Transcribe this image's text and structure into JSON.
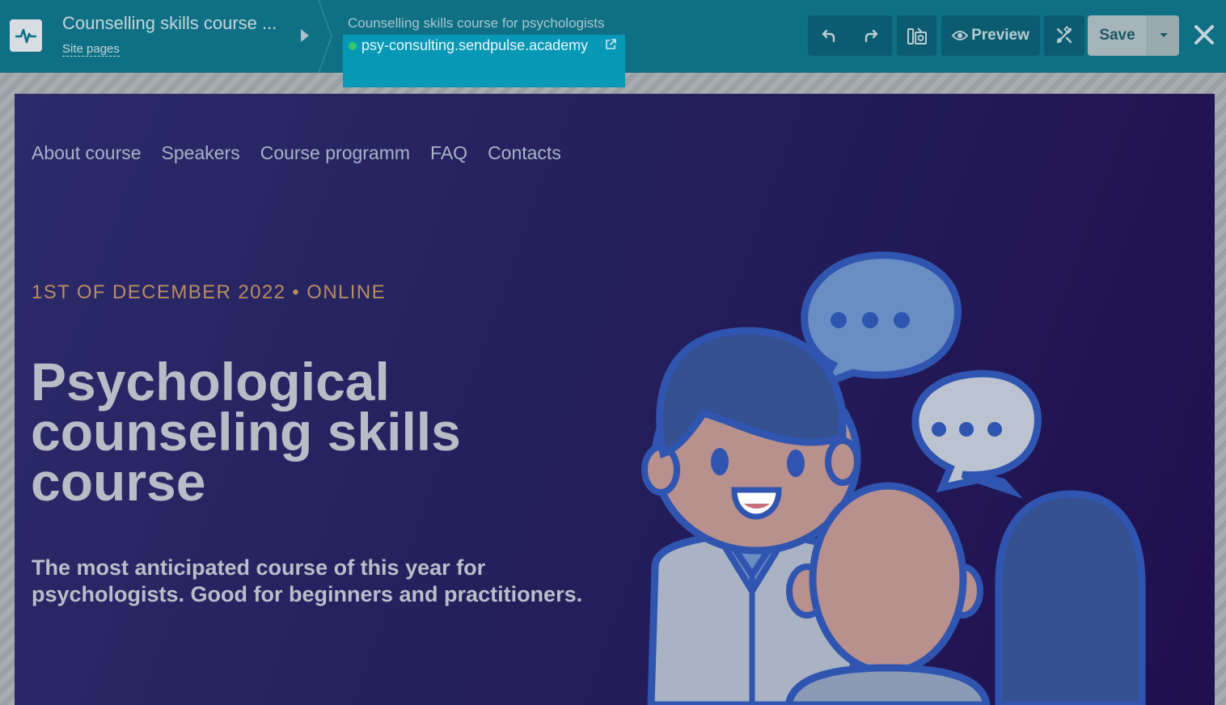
{
  "toolbar": {
    "site_title": "Counselling skills course ...",
    "site_pages_label": "Site pages",
    "page_name": "Counselling skills course for psychologists",
    "page_url": "psy-consulting.sendpulse.academy",
    "preview_label": "Preview",
    "save_label": "Save",
    "icons": [
      "pulse-logo-icon",
      "undo-icon",
      "redo-icon",
      "library-icon",
      "eye-icon",
      "tools-icon",
      "caret-down-icon",
      "close-icon",
      "external-link-icon"
    ],
    "colors": {
      "bar": "#0f6f84",
      "url_highlight": "#0798b6",
      "status_online": "#35c870"
    }
  },
  "landing": {
    "nav": [
      "About course",
      "Speakers",
      "Course programm",
      "FAQ",
      "Contacts"
    ],
    "event_date": "1ST OF DECEMBER 2022 • ONLINE",
    "title": "Psychological counseling skills course",
    "subtitle": "The most anticipated course of this year for psychologists. Good for beginners and practitioners.",
    "colors": {
      "accent": "#bb8d5e",
      "background": "#24205c"
    }
  }
}
